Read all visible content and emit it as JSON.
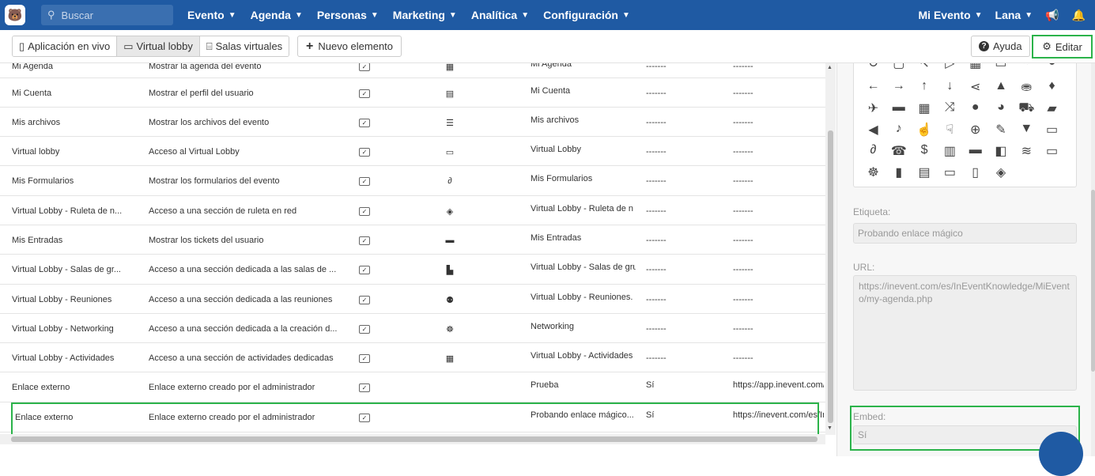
{
  "topbar": {
    "search_placeholder": "Buscar",
    "nav": [
      {
        "label": "Evento"
      },
      {
        "label": "Agenda"
      },
      {
        "label": "Personas"
      },
      {
        "label": "Marketing"
      },
      {
        "label": "Analítica"
      },
      {
        "label": "Configuración"
      }
    ],
    "right": {
      "event_label": "Mi Evento",
      "language_label": "Lana"
    }
  },
  "toolbar": {
    "tabs": [
      {
        "label": "Aplicación en vivo",
        "icon": "phone-icon"
      },
      {
        "label": "Virtual lobby",
        "icon": "monitor-icon",
        "active": true
      },
      {
        "label": "Salas virtuales",
        "icon": "rooms-icon"
      }
    ],
    "new_label": "Nuevo elemento",
    "help_label": "Ayuda",
    "edit_label": "Editar"
  },
  "table": {
    "rows": [
      {
        "name": "Mi Agenda",
        "desc": "Mostrar la agenda del evento",
        "icon": "calendar-icon",
        "label": "Mi Agenda",
        "embed": "-------",
        "url": "-------"
      },
      {
        "name": "Mi Cuenta",
        "desc": "Mostrar el perfil del usuario",
        "icon": "id-card-icon",
        "label": "Mi Cuenta",
        "embed": "-------",
        "url": "-------"
      },
      {
        "name": "Mis archivos",
        "desc": "Mostrar los archivos del evento",
        "icon": "list-icon",
        "label": "Mis archivos",
        "embed": "-------",
        "url": "-------"
      },
      {
        "name": "Virtual lobby",
        "desc": "Acceso al Virtual Lobby",
        "icon": "monitor-icon",
        "label": "Virtual Lobby",
        "embed": "-------",
        "url": "-------"
      },
      {
        "name": "Mis Formularios",
        "desc": "Mostrar los formularios del evento",
        "icon": "link-icon",
        "label": "Mis Formularios",
        "embed": "-------",
        "url": "-------"
      },
      {
        "name": "Virtual Lobby - Ruleta de n...",
        "desc": "Acceso a una sección de ruleta en red",
        "icon": "network-icon",
        "label": "Virtual Lobby - Ruleta de n",
        "embed": "-------",
        "url": "-------"
      },
      {
        "name": "Mis Entradas",
        "desc": "Mostrar los tickets del usuario",
        "icon": "ticket-icon",
        "label": "Mis Entradas",
        "embed": "-------",
        "url": "-------"
      },
      {
        "name": "Virtual Lobby - Salas de gr...",
        "desc": "Acceso a una sección dedicada a las salas de ...",
        "icon": "door-icon",
        "label": "Virtual Lobby - Salas de gru",
        "embed": "-------",
        "url": "-------"
      },
      {
        "name": "Virtual Lobby - Reuniones",
        "desc": "Acceso a una sección dedicada a las reuniones",
        "icon": "users-icon",
        "label": "Virtual Lobby - Reuniones.",
        "embed": "-------",
        "url": "-------"
      },
      {
        "name": "Virtual Lobby - Networking",
        "desc": "Acceso a una sección dedicada a la creación d...",
        "icon": "group-icon",
        "label": "Networking",
        "embed": "-------",
        "url": "-------"
      },
      {
        "name": "Virtual Lobby - Actividades",
        "desc": "Acceso a una sección de actividades dedicadas",
        "icon": "calendar-icon",
        "label": "Virtual Lobby - Actividades",
        "embed": "-------",
        "url": "-------"
      },
      {
        "name": "Enlace externo",
        "desc": "Enlace externo creado por el administrador",
        "icon": "",
        "label": "Prueba",
        "embed": "Sí",
        "url": "https://app.inevent.com/c"
      },
      {
        "name": "Enlace externo",
        "desc": "Enlace externo creado por el administrador",
        "icon": "",
        "label": "Probando enlace mágico...",
        "embed": "Sí",
        "url": "https://inevent.com/es/In"
      }
    ]
  },
  "panel": {
    "icon_rows": [
      [
        "↻",
        "▢",
        "↖",
        "▷",
        "▦",
        "▭",
        "◔",
        "◕"
      ],
      [
        "←",
        "→",
        "↑",
        "↓",
        "⋖",
        "▲",
        "⛂",
        "♦"
      ],
      [
        "✈",
        "▬",
        "▦",
        "⤨",
        "●",
        "◕",
        "⛟",
        "▰"
      ],
      [
        "◀",
        "♪",
        "☝",
        "☟",
        "⊕",
        "✎",
        "▼",
        "▭"
      ],
      [
        "∂",
        "☎",
        "$",
        "▥",
        "▬",
        "◧",
        "≋",
        "▭"
      ],
      [
        "☸",
        "▮",
        "▤",
        "▭",
        "▯",
        "◈"
      ]
    ],
    "label_label": "Etiqueta:",
    "label_value": "Probando enlace mágico",
    "url_label": "URL:",
    "url_value": "https://inevent.com/es/InEventKnowledge/MiEvento/my-agenda.php",
    "embed_label": "Embed:",
    "embed_value": "Sí"
  }
}
